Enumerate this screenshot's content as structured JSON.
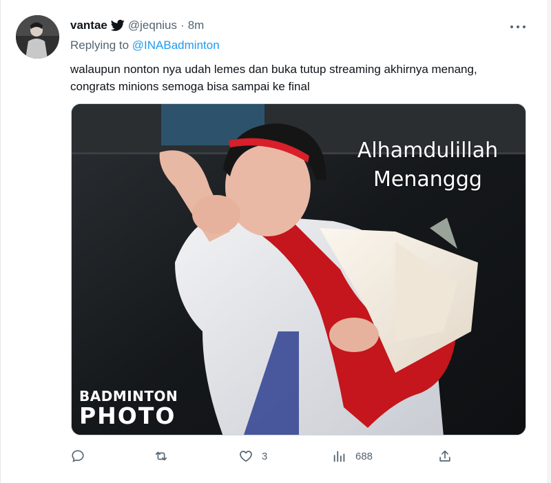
{
  "author": {
    "display_name": "vantae",
    "handle": "@jeqnius",
    "separator": "·",
    "time": "8m"
  },
  "reply": {
    "prefix": "Replying to",
    "mention": "@INABadminton"
  },
  "tweet": {
    "text": "walaupun nonton nya udah lemes dan buka tutup streaming akhirnya menang, congrats minions semoga bisa sampai ke final"
  },
  "media": {
    "overlay_line1": "Alhamdulillah",
    "overlay_line2": "Menanggg",
    "watermark_top": "BADMINTON",
    "watermark_bottom": "PHOTO"
  },
  "actions": {
    "reply_icon": "reply-icon",
    "retweet_icon": "retweet-icon",
    "like_icon": "heart-icon",
    "like_count": "3",
    "views_icon": "views-icon",
    "views_count": "688",
    "share_icon": "share-icon"
  },
  "colors": {
    "accent": "#1d9bf0",
    "secondary_text": "#536471",
    "primary_text": "#0f1419"
  }
}
